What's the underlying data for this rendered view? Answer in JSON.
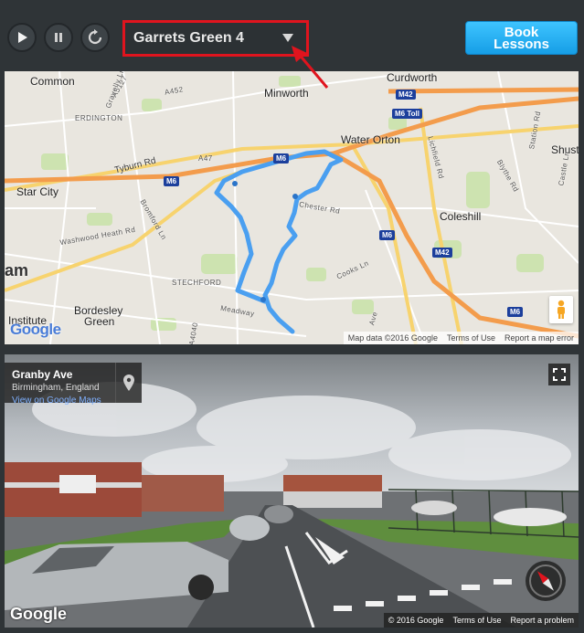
{
  "toolbar": {
    "route_name": "Garrets Green 4",
    "book_line1": "Book",
    "book_line2": "Lessons"
  },
  "colors": {
    "route": "#4a9ff0",
    "highlight": "#e0141e",
    "book_button": "#2cb6f5",
    "motorway_shield": "#1c3f9c"
  },
  "map": {
    "places": [
      {
        "name": "Common"
      },
      {
        "name": "Minworth"
      },
      {
        "name": "Curdworth"
      },
      {
        "name": "ERDINGTON"
      },
      {
        "name": "Water Orton"
      },
      {
        "name": "Star City"
      },
      {
        "name": "Coleshill"
      },
      {
        "name": "Shust"
      },
      {
        "name": "STECHFORD"
      },
      {
        "name": "Bordesley"
      },
      {
        "name": "Green"
      },
      {
        "name": "Institute"
      },
      {
        "name": "am"
      }
    ],
    "roads": [
      {
        "name": "A452"
      },
      {
        "name": "A5127"
      },
      {
        "name": "Tyburn Rd"
      },
      {
        "name": "A47"
      },
      {
        "name": "Washwood Heath Rd"
      },
      {
        "name": "Bromford Ln"
      },
      {
        "name": "Chester Rd"
      },
      {
        "name": "Cooks Ln"
      },
      {
        "name": "Meadway"
      },
      {
        "name": "Lichfield Rd"
      },
      {
        "name": "Blythe Rd"
      },
      {
        "name": "Station Rd"
      },
      {
        "name": "Castle Ln"
      },
      {
        "name": "Gravelly Ln"
      },
      {
        "name": "A4040"
      },
      {
        "name": "Ave"
      }
    ],
    "shields": [
      "M42",
      "M6 Toll",
      "M6",
      "M6",
      "M6",
      "M42",
      "M6"
    ],
    "attribution": [
      "Map data ©2016 Google",
      "Terms of Use",
      "Report a map error"
    ],
    "google": "Google"
  },
  "street_view": {
    "title": "Granby Ave",
    "subtitle": "Birmingham, England",
    "link": "View on Google Maps",
    "attribution": [
      "© 2016 Google",
      "Terms of Use",
      "Report a problem"
    ],
    "google": "Google"
  },
  "icons": {
    "play": "play-icon",
    "pause": "pause-icon",
    "restart": "restart-icon",
    "dropdown": "chevron-down-icon",
    "pegman": "pegman-icon",
    "pin": "map-pin-icon",
    "fullscreen": "fullscreen-icon",
    "compass": "compass-icon"
  }
}
